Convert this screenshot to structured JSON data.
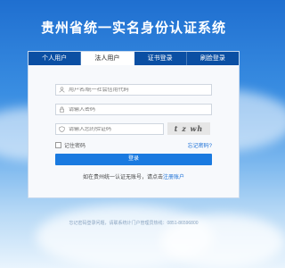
{
  "page": {
    "title": "贵州省统一实名身份认证系统",
    "footer": "忘记密码登录问题，请联系统计门户管理员热线：0851-86596800"
  },
  "tabs": [
    {
      "label": "个人用户"
    },
    {
      "label": "法人用户"
    },
    {
      "label": "证书登录"
    },
    {
      "label": "刷脸登录"
    }
  ],
  "form": {
    "username_placeholder": "用户名/统一社会信用代码",
    "password_placeholder": "请输入密码",
    "captcha_placeholder": "请输入您的验证码",
    "captcha_text": "t z wh",
    "remember_label": "记住密码",
    "forgot_label": "忘记密码?",
    "login_label": "登录",
    "bind_text": "如在贵州统一认证无账号，请点击",
    "bind_link": "注册账户"
  },
  "colors": {
    "tab_bar": "#0b4fa3",
    "login_button": "#1a7ae0",
    "link": "#1a6fd6"
  }
}
